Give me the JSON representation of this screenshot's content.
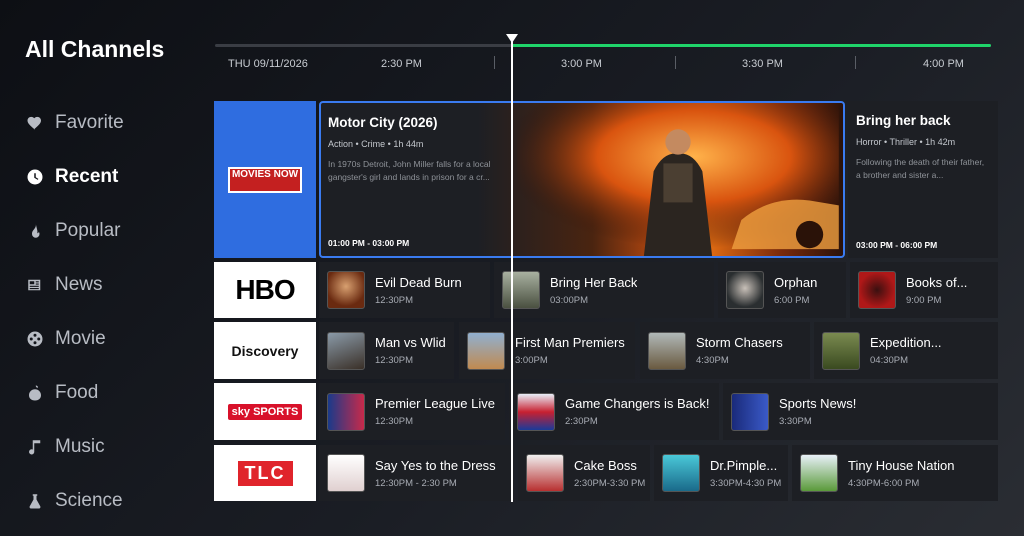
{
  "header": {
    "title": "All Channels"
  },
  "sidebar": {
    "items": [
      {
        "label": "Favorite",
        "icon": "heart-icon"
      },
      {
        "label": "Recent",
        "icon": "clock-icon"
      },
      {
        "label": "Popular",
        "icon": "flame-icon"
      },
      {
        "label": "News",
        "icon": "news-icon"
      },
      {
        "label": "Movie",
        "icon": "film-reel-icon"
      },
      {
        "label": "Food",
        "icon": "food-icon"
      },
      {
        "label": "Music",
        "icon": "music-note-icon"
      },
      {
        "label": "Science",
        "icon": "science-icon"
      }
    ],
    "active": "Recent"
  },
  "timeline": {
    "date": "THU 09/11/2026",
    "times": [
      "2:30 PM",
      "3:00 PM",
      "3:30 PM",
      "4:00 PM"
    ],
    "progress_color": "#1fd46a"
  },
  "channels": {
    "movies_now": {
      "logo": "MOVIES NOW"
    },
    "hbo": {
      "logo": "HBO"
    },
    "discovery": {
      "logo": "Discovery"
    },
    "sky": {
      "logo": "sky SPORTS"
    },
    "tlc": {
      "logo": "TLC"
    }
  },
  "featured": {
    "title": "Motor City (2026)",
    "meta": "Action  •  Crime  •  1h 44m",
    "desc": "In 1970s Detroit, John Miller falls for a local gangster's girl and lands in prison for a cr...",
    "time": "01:00 PM - 03:00 PM"
  },
  "featured_next": {
    "title": "Bring her back",
    "meta": "Horror  •  Thriller  •  1h 42m",
    "desc": "Following the death of their father, a brother and sister a...",
    "time": "03:00 PM - 06:00 PM"
  },
  "rows": {
    "hbo": [
      {
        "title": "Evil Dead Burn",
        "time": "12:30PM"
      },
      {
        "title": "Bring Her Back",
        "time": "03:00PM"
      },
      {
        "title": "Orphan",
        "time": "6:00 PM"
      },
      {
        "title": "Books of...",
        "time": "9:00 PM"
      }
    ],
    "discovery": [
      {
        "title": "Man vs Wlid",
        "time": "12:30PM"
      },
      {
        "title": "First Man Premiers",
        "time": "3:00PM"
      },
      {
        "title": "Storm Chasers",
        "time": "4:30PM"
      },
      {
        "title": "Expedition...",
        "time": "04:30PM"
      }
    ],
    "sky": [
      {
        "title": "Premier League Live",
        "time": "12:30PM"
      },
      {
        "title": "Game Changers is Back!",
        "time": "2:30PM"
      },
      {
        "title": "Sports News!",
        "time": "3:30PM"
      }
    ],
    "tlc": [
      {
        "title": "Say Yes to the Dress",
        "time": "12:30PM - 2:30 PM"
      },
      {
        "title": "Cake Boss",
        "time": "2:30PM-3:30 PM"
      },
      {
        "title": "Dr.Pimple...",
        "time": "3:30PM-4:30 PM"
      },
      {
        "title": "Tiny House Nation",
        "time": "4:30PM-6:00 PM"
      }
    ]
  },
  "colors": {
    "accent": "#3a7bf0",
    "progress": "#1fd46a",
    "card": "#1d1f24"
  }
}
